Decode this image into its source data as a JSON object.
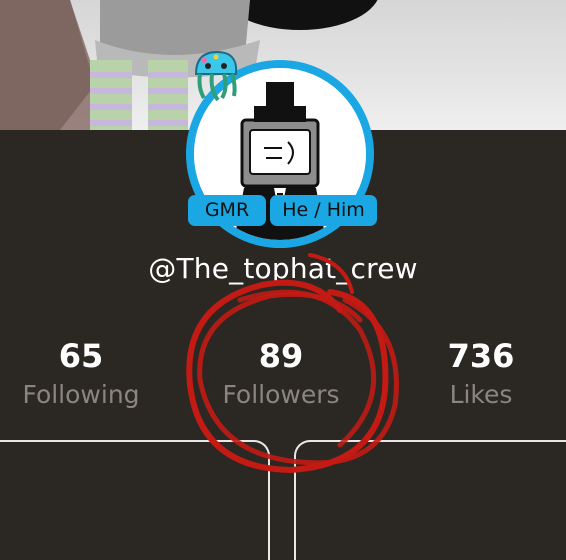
{
  "profile": {
    "username": "@The_tophat_crew",
    "badges": [
      "GMR",
      "He / Him"
    ],
    "avatar_icon": "tophat-tv-head-avatar",
    "decoration_icon": "jellyfish-icon"
  },
  "stats": {
    "following": {
      "value": "65",
      "label": "Following"
    },
    "followers": {
      "value": "89",
      "label": "Followers"
    },
    "likes": {
      "value": "736",
      "label": "Likes"
    }
  },
  "colors": {
    "background": "#2b2823",
    "accent": "#1aa7e4",
    "text": "#ffffff",
    "muted": "#8a857e",
    "annotation": "#c41a14"
  }
}
